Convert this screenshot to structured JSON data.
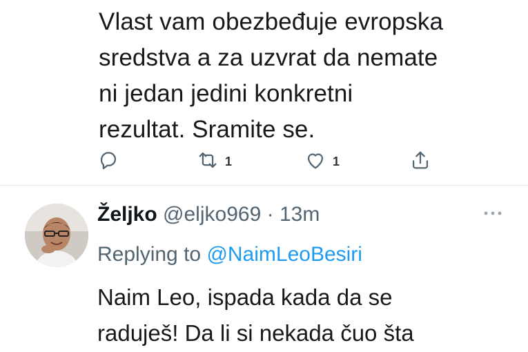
{
  "tweet_top": {
    "text": "Vlast vam obezbeđuje evropska\nsredstva a za uzvrat da nemate\nni jedan jedini konkretni\nrezultat. Sramite se.",
    "actions": {
      "reply_count": "",
      "retweet_count": "1",
      "like_count": "1"
    }
  },
  "tweet_reply": {
    "display_name": "Željko",
    "handle": "@eljko969",
    "separator": "·",
    "time": "13m",
    "replying_label": "Replying to",
    "replying_to": "@NaimLeoBesiri",
    "text": "Naim Leo, ispada kada da se\nraduješ! Da li si nekada čuo šta"
  },
  "icons": [
    "reply-icon",
    "retweet-icon",
    "like-icon",
    "share-icon",
    "more-icon"
  ],
  "colors": {
    "accent": "#1d9bf0",
    "muted": "#536471",
    "text": "#0f1419"
  }
}
